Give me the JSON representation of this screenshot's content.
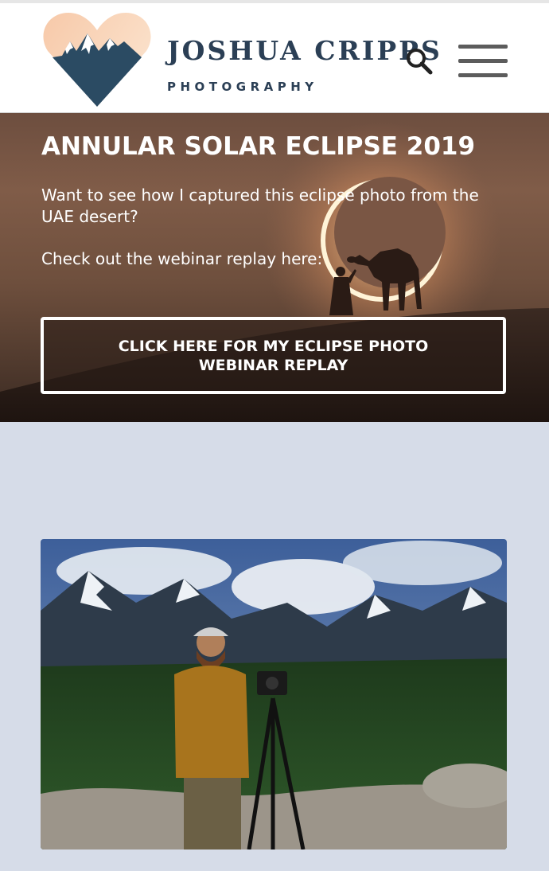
{
  "header": {
    "brand_name": "JOSHUA CRIPPS",
    "brand_sub": "PHOTOGRAPHY",
    "icons": {
      "logo": "heart-mountain-logo",
      "search": "search-icon",
      "menu": "hamburger-menu-icon"
    }
  },
  "hero": {
    "title": "ANNULAR SOLAR ECLIPSE 2019",
    "paragraph_1": "Want to see how I captured this eclipse photo from the UAE desert?",
    "paragraph_2": "Check out the webinar replay here:",
    "cta_label": "CLICK HERE FOR MY ECLIPSE PHOTO WEBINAR REPLAY"
  },
  "colors": {
    "brand": "#2b3f55",
    "page_background": "#d6dce8",
    "hero_overlay": "#6e4f3d"
  }
}
